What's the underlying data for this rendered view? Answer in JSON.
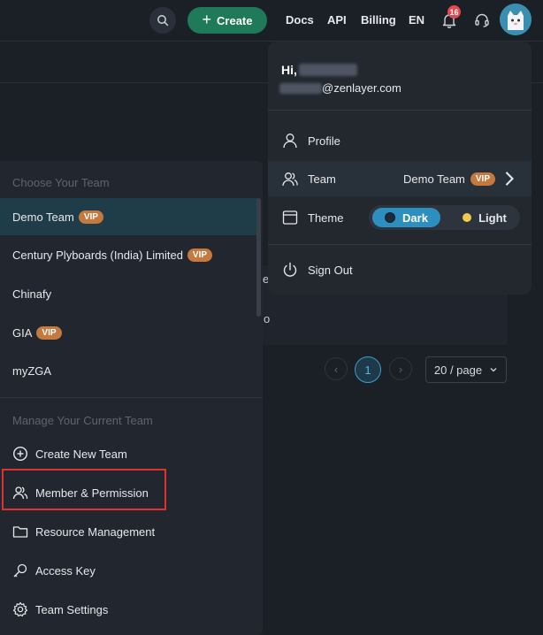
{
  "header": {
    "create_label": "Create",
    "nav": [
      "Docs",
      "API",
      "Billing",
      "EN"
    ],
    "notification_count": "16"
  },
  "background": {
    "row_fragment_1": "e",
    "row_fragment_2": "o",
    "pagination": {
      "current_page": "1",
      "page_size": "20 / page"
    }
  },
  "team_panel": {
    "choose_title": "Choose Your Team",
    "teams": [
      {
        "name": "Demo Team",
        "vip": "VIP"
      },
      {
        "name": "Century Plyboards (India) Limited",
        "vip": "VIP"
      },
      {
        "name": "Chinafy",
        "vip": ""
      },
      {
        "name": "GIA",
        "vip": "VIP"
      },
      {
        "name": "myZGA",
        "vip": ""
      }
    ],
    "manage_title": "Manage Your Current Team",
    "manage_items": [
      "Create New Team",
      "Member & Permission",
      "Resource Management",
      "Access Key",
      "Team Settings"
    ]
  },
  "user_menu": {
    "greeting": "Hi,",
    "email_suffix": "@zenlayer.com",
    "profile_label": "Profile",
    "team_label": "Team",
    "current_team": "Demo Team",
    "current_team_badge": "VIP",
    "theme_label": "Theme",
    "theme_dark": "Dark",
    "theme_light": "Light",
    "sign_out": "Sign Out"
  },
  "colors": {
    "accent": "#2d8fbf",
    "create_button": "#1f7a5a",
    "vip_badge": "#c47a3e",
    "notification": "#e5484d",
    "highlight": "#e03131"
  }
}
